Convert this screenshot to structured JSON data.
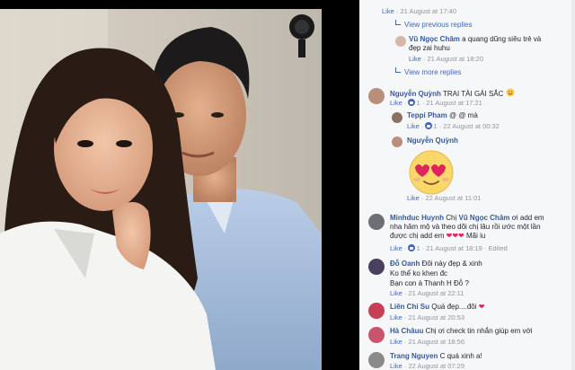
{
  "comments": {
    "top_meta": {
      "like": "Like",
      "time": "21 August at 17:40"
    },
    "view_previous": "View previous replies",
    "reply1": {
      "name": "Vũ Ngọc Châm",
      "text": "a quang dũng siêu trẻ và đẹp zai huhu",
      "like": "Like",
      "time": "21 August at 18:20"
    },
    "view_more": "View more replies",
    "c1": {
      "name": "Nguyễn Quỳnh",
      "text": "TRAI TÀI GÁI SẮC",
      "like": "Like",
      "likes": "1",
      "time": "21 August at 17:21"
    },
    "c1_reply1": {
      "name": "Teppi Pham",
      "text": "@ @ mà",
      "like": "Like",
      "likes": "1",
      "time": "22 August at 00:32"
    },
    "c1_reply2": {
      "name": "Nguyễn Quỳnh",
      "like": "Like",
      "time": "22 August at 11:01"
    },
    "c2": {
      "name": "Minhduc Huynh",
      "mention": "Vũ Ngọc Châm",
      "text_before": "Chị",
      "text_after": "ơi add em nha hâm mộ và theo dõi chị lâu rồi ước một lần được chị add em",
      "text_end": "Mãi iu",
      "like": "Like",
      "likes": "1",
      "time": "21 August at 18:19",
      "edited": "Edited"
    },
    "c3": {
      "name": "Đỗ Oanh",
      "text": "Đôi này đẹp & xinh",
      "text2": "Ko thể ko khen đc",
      "text3": "Bạn con à Thanh H Đỗ ?",
      "like": "Like",
      "time": "21 August at 22:11"
    },
    "c4": {
      "name": "Liên Chi Su",
      "text": "Quá đẹp....đôi",
      "like": "Like",
      "time": "21 August at 20:53"
    },
    "c5": {
      "name": "Hà Châuu",
      "text": "Chị ơi check tin nhắn giúp em với",
      "like": "Like",
      "time": "21 August at 18:56"
    },
    "c6": {
      "name": "Trang Nguyen",
      "text": "C quá xinh a!",
      "like": "Like",
      "time": "22 August at 07:29"
    }
  },
  "colors": {
    "link": "#365899",
    "panel_bg": "#f6f7f9",
    "meta": "#90949c",
    "heart": "#e0245e"
  }
}
